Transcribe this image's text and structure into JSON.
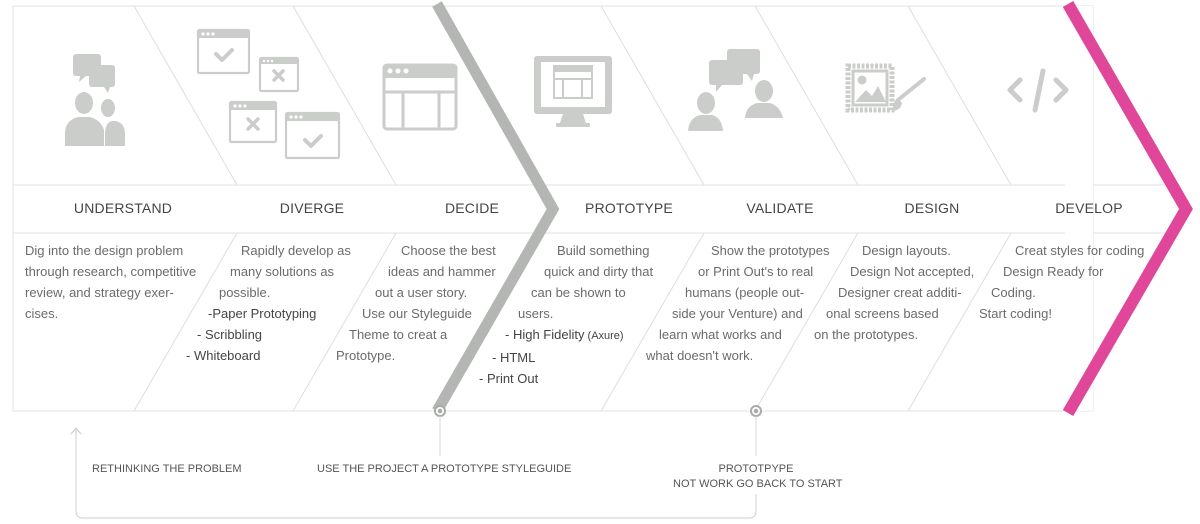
{
  "colors": {
    "icon": "#cbcdca",
    "divider": "#e2e2e2",
    "decide_chevron": "#b4b6b3",
    "develop_chevron": "#e0479b",
    "text": "#555555"
  },
  "phases": [
    {
      "label": "UNDERSTAND",
      "icon": "people-chat-icon",
      "description": [
        {
          "text": "Dig into the design problem"
        },
        {
          "text": "through research, competitive"
        },
        {
          "text": "review, and strategy exer-"
        },
        {
          "text": "cises."
        }
      ]
    },
    {
      "label": "DIVERGE",
      "icon": "multiple-windows-icon",
      "description": [
        {
          "text": "Rapidly develop as"
        },
        {
          "text": "many solutions as"
        },
        {
          "text": "possible."
        },
        {
          "text": "-Paper Prototyping",
          "bold": true
        },
        {
          "text": "- Scribbling",
          "bold": true
        },
        {
          "text": "- Whiteboard",
          "bold": true
        }
      ]
    },
    {
      "label": "DECIDE",
      "icon": "layout-window-icon",
      "description": [
        {
          "text": "Choose the best"
        },
        {
          "text": "ideas and hammer"
        },
        {
          "text": "out a user story."
        },
        {
          "text": "Use our Styleguide"
        },
        {
          "text": "Theme to creat a"
        },
        {
          "text": "Prototype."
        }
      ]
    },
    {
      "label": "PROTOTYPE",
      "icon": "monitor-icon",
      "description": [
        {
          "text": "Build something"
        },
        {
          "text": "quick and dirty that"
        },
        {
          "text": "can be shown to"
        },
        {
          "text": "users."
        },
        {
          "text": "- High Fidelity",
          "suffix": " (Axure)",
          "bold": true
        },
        {
          "text": "- HTML",
          "bold": true
        },
        {
          "text": "- Print Out",
          "bold": true
        }
      ]
    },
    {
      "label": "VALIDATE",
      "icon": "users-conversation-icon",
      "description": [
        {
          "text": "Show the prototypes"
        },
        {
          "text": "or Print Out's to real"
        },
        {
          "text": "humans (people out-"
        },
        {
          "text": "side your Venture) and"
        },
        {
          "text": "learn what works and"
        },
        {
          "text": "what doesn't work."
        }
      ]
    },
    {
      "label": "DESIGN",
      "icon": "image-brush-icon",
      "description": [
        {
          "text": "Design layouts."
        },
        {
          "text": "Design Not accepted,"
        },
        {
          "text": "Designer creat additi-"
        },
        {
          "text": "onal screens based"
        },
        {
          "text": "on the prototypes."
        }
      ]
    },
    {
      "label": "DEVELOP",
      "icon": "code-icon",
      "description": [
        {
          "text": "Creat styles for coding"
        },
        {
          "text": "Design Ready for"
        },
        {
          "text": "Coding."
        },
        {
          "text": "Start coding!"
        }
      ]
    }
  ],
  "notes": {
    "rethinking": "RETHINKING THE PROBLEM",
    "styleguide": "USE THE PROJECT A PROTOTYPE STYLEGUIDE",
    "prototype_fail": [
      "PROTOTPYPE",
      "NOT WORK GO BACK TO START"
    ]
  }
}
